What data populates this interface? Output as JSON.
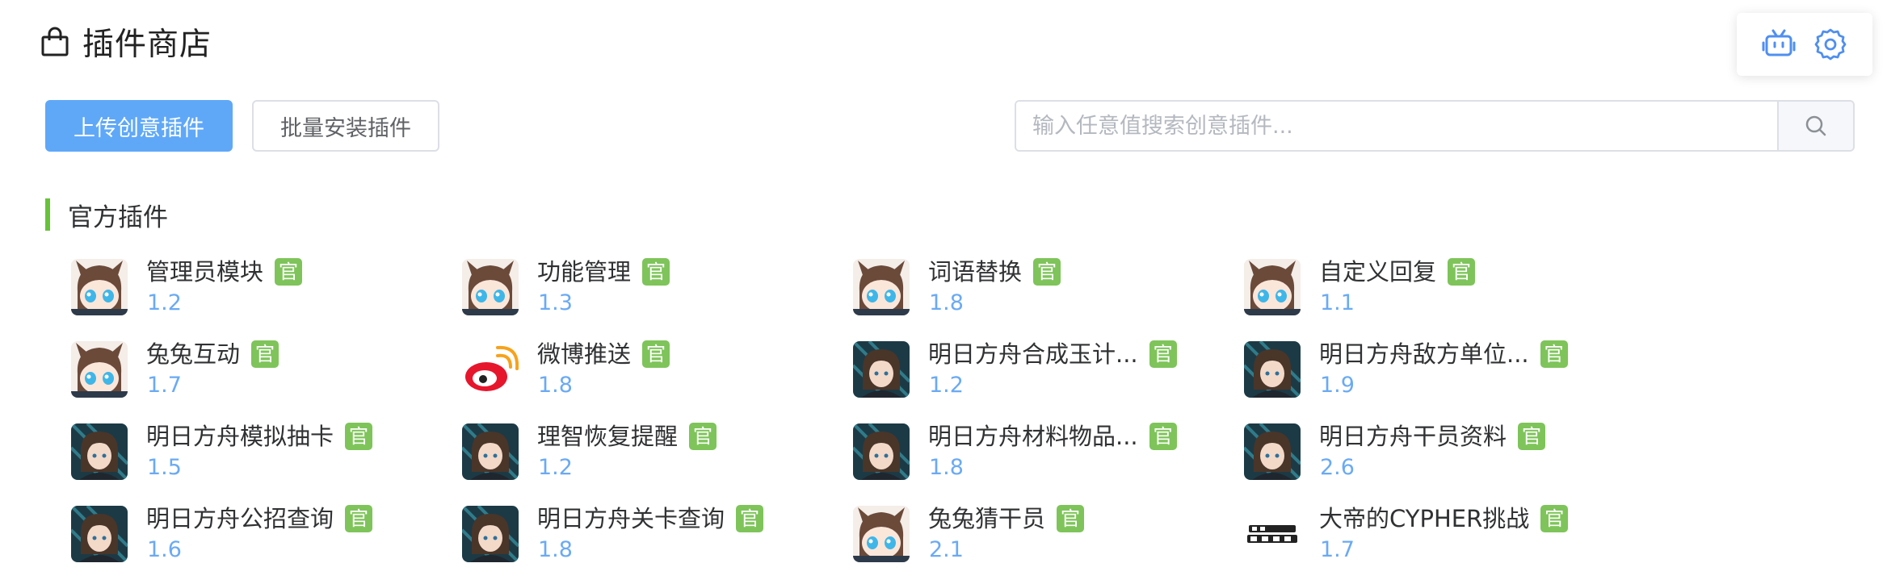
{
  "header": {
    "title": "插件商店",
    "icon": "shopping-bag-icon"
  },
  "float_panel": {
    "icons": [
      "robot-icon",
      "gear-icon"
    ]
  },
  "toolbar": {
    "upload_label": "上传创意插件",
    "batch_install_label": "批量安装插件"
  },
  "search": {
    "placeholder": "输入任意值搜索创意插件...",
    "value": "",
    "icon": "search-icon"
  },
  "section": {
    "title": "官方插件",
    "accent_color": "#67c23a"
  },
  "colors": {
    "primary": "#5fa8f8",
    "badge": "#7ec45a",
    "version": "#6aaaf4"
  },
  "plugins": [
    {
      "name": "管理员模块",
      "badge": "官",
      "version": "1.2",
      "icon": "amiya-chibi"
    },
    {
      "name": "功能管理",
      "badge": "官",
      "version": "1.3",
      "icon": "amiya-chibi"
    },
    {
      "name": "词语替换",
      "badge": "官",
      "version": "1.8",
      "icon": "amiya-chibi"
    },
    {
      "name": "自定义回复",
      "badge": "官",
      "version": "1.1",
      "icon": "amiya-chibi"
    },
    {
      "name": "兔兔互动",
      "badge": "官",
      "version": "1.7",
      "icon": "amiya-chibi"
    },
    {
      "name": "微博推送",
      "badge": "官",
      "version": "1.8",
      "icon": "weibo-logo"
    },
    {
      "name": "明日方舟合成玉计...",
      "badge": "官",
      "version": "1.2",
      "icon": "amiya-portrait"
    },
    {
      "name": "明日方舟敌方单位...",
      "badge": "官",
      "version": "1.9",
      "icon": "amiya-portrait"
    },
    {
      "name": "明日方舟模拟抽卡",
      "badge": "官",
      "version": "1.5",
      "icon": "amiya-portrait"
    },
    {
      "name": "理智恢复提醒",
      "badge": "官",
      "version": "1.2",
      "icon": "amiya-portrait"
    },
    {
      "name": "明日方舟材料物品...",
      "badge": "官",
      "version": "1.8",
      "icon": "amiya-portrait"
    },
    {
      "name": "明日方舟干员资料",
      "badge": "官",
      "version": "2.6",
      "icon": "amiya-portrait"
    },
    {
      "name": "明日方舟公招查询",
      "badge": "官",
      "version": "1.6",
      "icon": "amiya-portrait"
    },
    {
      "name": "明日方舟关卡查询",
      "badge": "官",
      "version": "1.8",
      "icon": "amiya-portrait"
    },
    {
      "name": "兔兔猜干员",
      "badge": "官",
      "version": "2.1",
      "icon": "amiya-chibi"
    },
    {
      "name": "大帝的CYPHER挑战",
      "badge": "官",
      "version": "1.7",
      "icon": "cypher-logo"
    }
  ]
}
